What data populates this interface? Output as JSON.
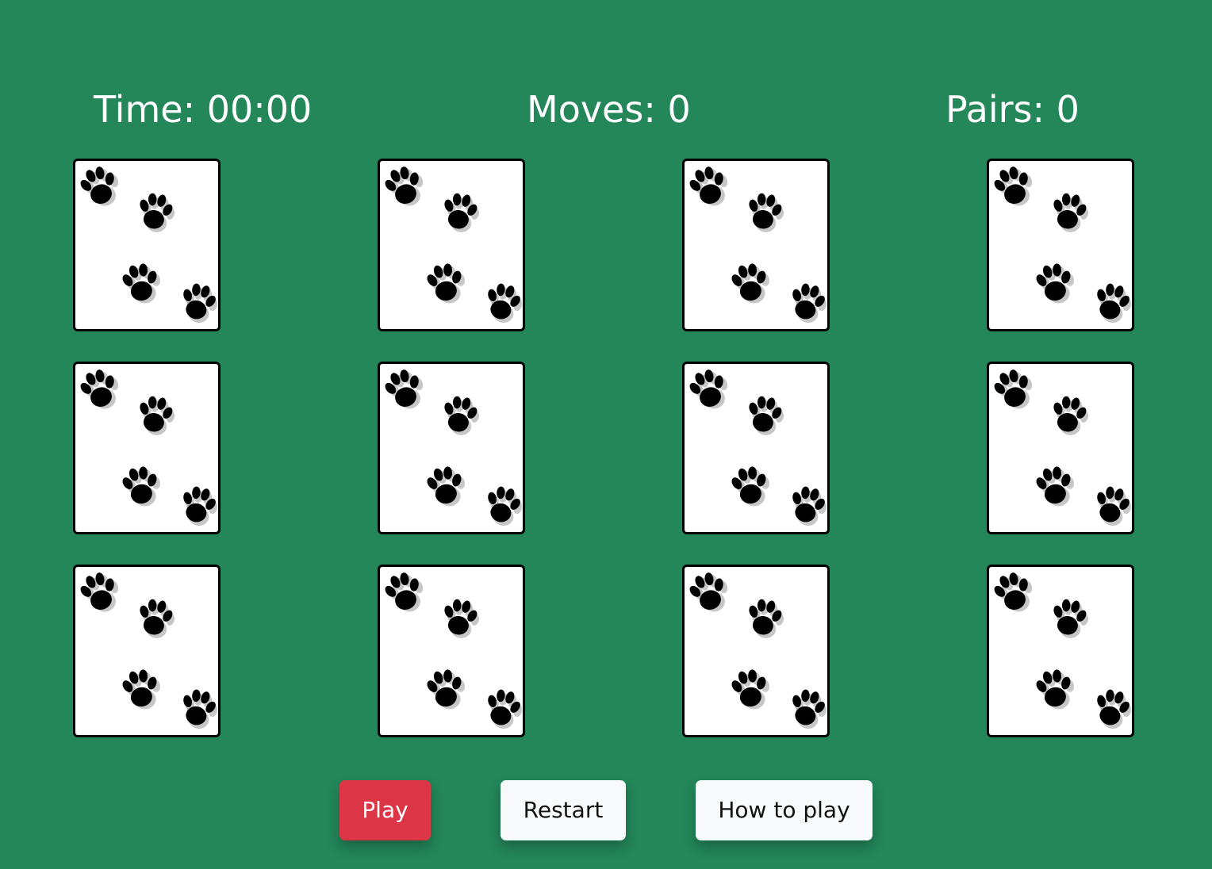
{
  "stats": {
    "time_label": "Time: ",
    "time_value": "00:00",
    "moves_label": "Moves: ",
    "moves_value": "0",
    "pairs_label": "Pairs: ",
    "pairs_value": "0"
  },
  "board": {
    "rows": 3,
    "columns": 4,
    "card_back_icon": "paw-prints-icon",
    "card_state": "face-down"
  },
  "buttons": {
    "play": "Play",
    "restart": "Restart",
    "how_to_play": "How to play"
  },
  "colors": {
    "background": "#23875a",
    "play_button": "#dc3545",
    "secondary_button": "#f8f9fa",
    "card_face": "#ffffff",
    "card_border": "#000000"
  }
}
